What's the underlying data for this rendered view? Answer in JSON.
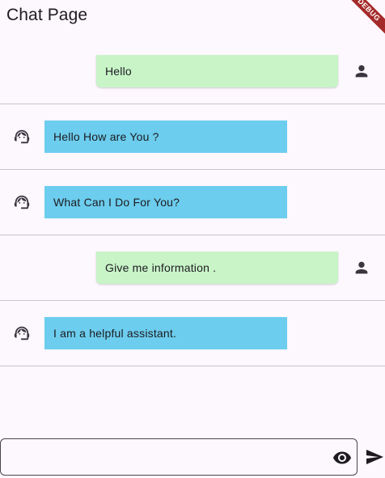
{
  "app_bar": {
    "title": "Chat Page",
    "debug_banner": "DEBUG"
  },
  "messages": [
    {
      "sender": "user",
      "text": "Hello",
      "icon": "person-icon"
    },
    {
      "sender": "bot",
      "text": "Hello How are You ?",
      "icon": "support-agent-icon"
    },
    {
      "sender": "bot",
      "text": "What Can I Do For You?",
      "icon": "support-agent-icon"
    },
    {
      "sender": "user",
      "text": "Give me information .",
      "icon": "person-icon"
    },
    {
      "sender": "bot",
      "text": "I am a helpful assistant.",
      "icon": "support-agent-icon"
    }
  ],
  "composer": {
    "value": "",
    "placeholder": "",
    "visibility_icon": "eye-icon",
    "send_icon": "send-icon"
  },
  "colors": {
    "background": "#fdf7fe",
    "user_bubble": "#c8f4c8",
    "bot_bubble": "#6ccdee",
    "divider": "#cac4cf",
    "icon": "#49454f",
    "debug_banner": "#a52a2a"
  }
}
